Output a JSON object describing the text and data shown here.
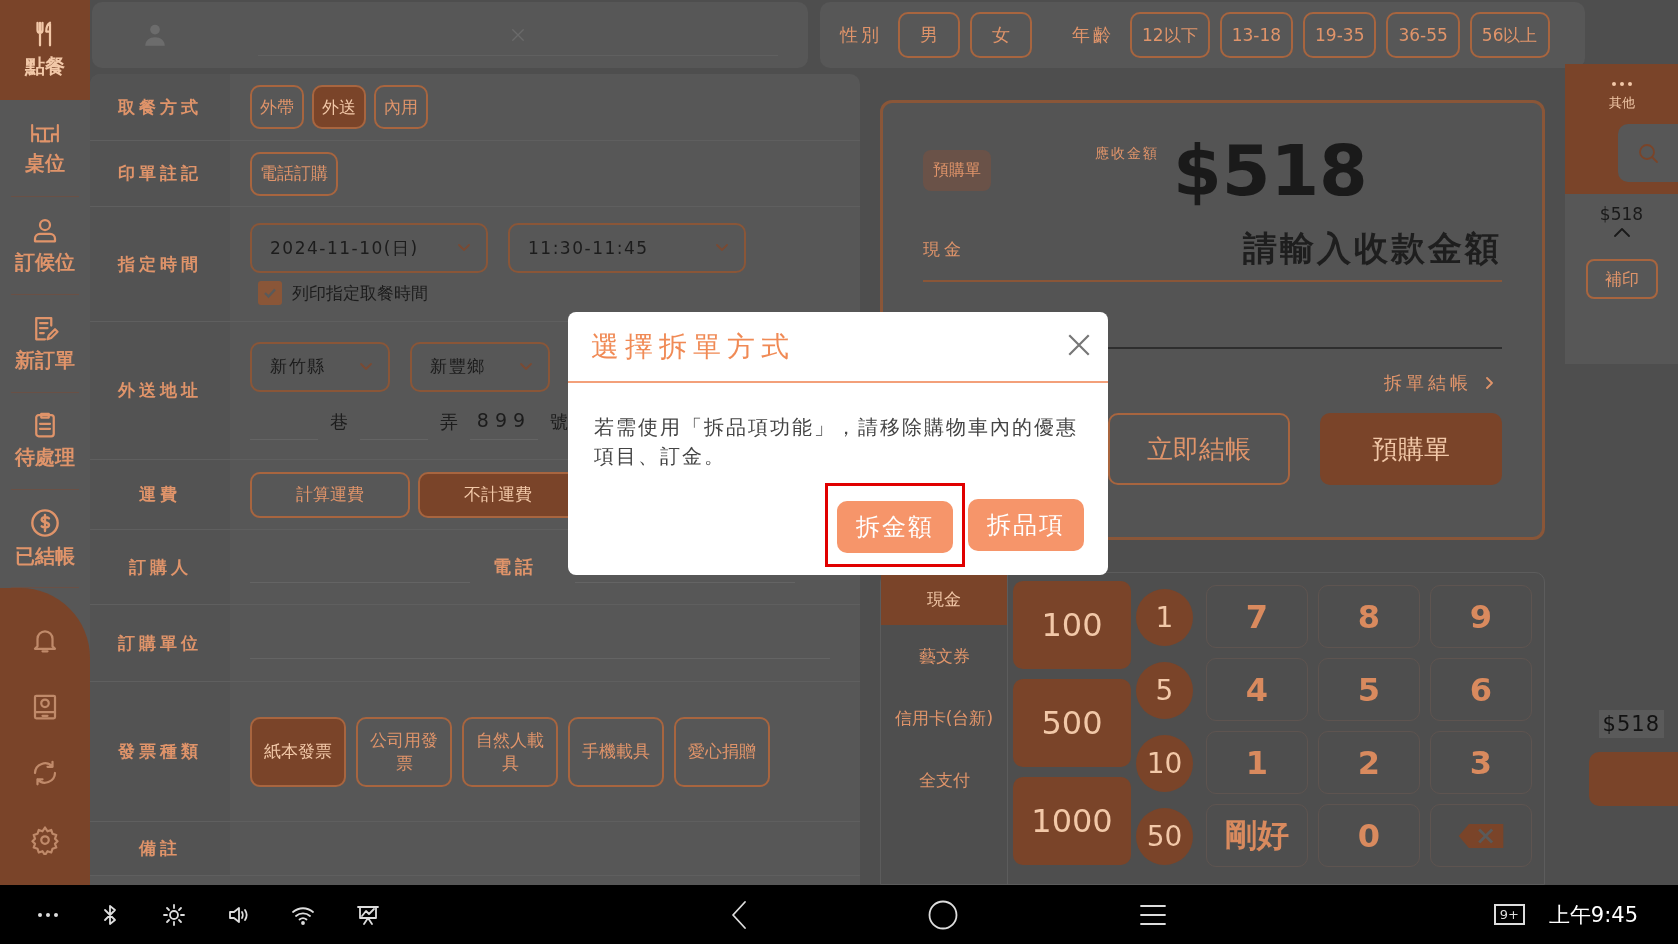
{
  "sidebar": {
    "items": [
      {
        "label": "點餐",
        "selected": true
      },
      {
        "label": "桌位",
        "selected": false
      },
      {
        "label": "訂候位",
        "selected": false
      },
      {
        "label": "新訂單",
        "selected": false
      },
      {
        "label": "待處理",
        "selected": false
      },
      {
        "label": "已結帳",
        "selected": false
      }
    ]
  },
  "demographics": {
    "gender_label": "性別",
    "genders": [
      {
        "label": "男",
        "selected": false
      },
      {
        "label": "女",
        "selected": false
      }
    ],
    "age_label": "年齡",
    "ages": [
      {
        "label": "12以下",
        "selected": false
      },
      {
        "label": "13-18",
        "selected": false
      },
      {
        "label": "19-35",
        "selected": false
      },
      {
        "label": "36-55",
        "selected": false
      },
      {
        "label": "56以上",
        "selected": false
      }
    ]
  },
  "order_form": {
    "pickup": {
      "label": "取餐方式",
      "options": [
        {
          "label": "外帶",
          "selected": false
        },
        {
          "label": "外送",
          "selected": true
        },
        {
          "label": "內用",
          "selected": false
        }
      ]
    },
    "print_note": {
      "label": "印單註記",
      "tags": [
        {
          "label": "電話訂購",
          "selected": false
        }
      ]
    },
    "scheduled_time": {
      "label": "指定時間",
      "date": "2024-11-10(日)",
      "time": "11:30-11:45",
      "print_time": {
        "label": "列印指定取餐時間",
        "checked": true
      }
    },
    "address": {
      "label": "外送地址",
      "county": "新竹縣",
      "township": "新豐鄉",
      "lane_unit": "巷",
      "alley_unit": "弄",
      "number": "899",
      "number_unit": "號"
    },
    "shipping": {
      "label": "運費",
      "options": [
        {
          "label": "計算運費",
          "selected": false
        },
        {
          "label": "不計運費",
          "selected": true
        }
      ]
    },
    "buyer": {
      "label": "訂購人",
      "phone_label": "電話"
    },
    "buyer_unit": {
      "label": "訂購單位"
    },
    "invoice": {
      "label": "發票種類",
      "options": [
        {
          "label": "紙本發票",
          "selected": true
        },
        {
          "label": "公司用發票",
          "selected": false
        },
        {
          "label": "自然人載具",
          "selected": false
        },
        {
          "label": "手機載具",
          "selected": false
        },
        {
          "label": "愛心捐贈",
          "selected": false
        }
      ]
    },
    "remark": {
      "label": "備註"
    }
  },
  "payment": {
    "tag": "預購單",
    "due_label": "應收金額",
    "due_amount": "$518",
    "cash_label": "現金",
    "cash_placeholder": "請輸入收款金額",
    "split_link": "拆單結帳",
    "buttons": [
      {
        "label": "立即結帳",
        "kind": "outline"
      },
      {
        "label": "預購單",
        "kind": "filled"
      }
    ],
    "methods": [
      {
        "label": "現金",
        "selected": true
      },
      {
        "label": "藝文券",
        "selected": false
      },
      {
        "label": "信用卡(台新)",
        "selected": false
      },
      {
        "label": "全支付",
        "selected": false
      }
    ],
    "bills": [
      "100",
      "500",
      "1000"
    ],
    "coins": [
      "1",
      "5",
      "10",
      "50"
    ],
    "keypad": [
      {
        "label": "7",
        "kind": "key"
      },
      {
        "label": "8",
        "kind": "key"
      },
      {
        "label": "9",
        "kind": "key"
      },
      {
        "label": "4",
        "kind": "key"
      },
      {
        "label": "5",
        "kind": "key"
      },
      {
        "label": "6",
        "kind": "key"
      },
      {
        "label": "1",
        "kind": "key"
      },
      {
        "label": "2",
        "kind": "key"
      },
      {
        "label": "3",
        "kind": "key"
      },
      {
        "label": "剛好",
        "kind": "key"
      },
      {
        "label": "0",
        "kind": "key"
      },
      {
        "kind": "backspace"
      }
    ]
  },
  "right_strip": {
    "more_label": "其他",
    "total": "$518",
    "reprint": "補印",
    "total_bottom": "$518"
  },
  "dialog": {
    "title": "選擇拆單方式",
    "message": "若需使用「拆品項功能」，請移除購物車內的優惠項目、訂金。",
    "buttons": [
      {
        "label": "拆金額",
        "highlighted": true
      },
      {
        "label": "拆品項",
        "highlighted": false
      }
    ]
  },
  "status_bar": {
    "notification_count": "9+",
    "time": "上午9:45"
  }
}
